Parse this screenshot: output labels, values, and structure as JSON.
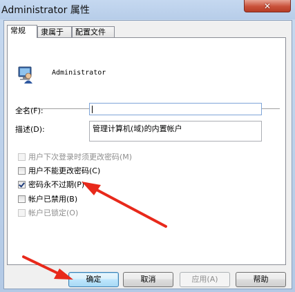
{
  "window": {
    "title": "Administrator 属性",
    "close_glyph": "✕"
  },
  "tabs": [
    {
      "label": "常规",
      "active": true
    },
    {
      "label": "隶属于",
      "active": false
    },
    {
      "label": "配置文件",
      "active": false
    }
  ],
  "user": {
    "icon": "user-account-icon",
    "name": "Administrator"
  },
  "form": {
    "fullname_label": "全名(F):",
    "fullname_value": "",
    "description_label": "描述(D):",
    "description_value": "管理计算机(域)的内置帐户"
  },
  "options": [
    {
      "label": "用户下次登录时须更改密码(M)",
      "checked": false,
      "disabled": true
    },
    {
      "label": "用户不能更改密码(C)",
      "checked": false,
      "disabled": false
    },
    {
      "label": "密码永不过期(P)",
      "checked": true,
      "disabled": false
    },
    {
      "label": "帐户已禁用(B)",
      "checked": false,
      "disabled": false
    },
    {
      "label": "帐户已锁定(O)",
      "checked": false,
      "disabled": true
    }
  ],
  "buttons": {
    "ok": "确定",
    "cancel": "取消",
    "apply": "应用(A)",
    "help": "帮助"
  },
  "annotation_color": "#e8291b"
}
